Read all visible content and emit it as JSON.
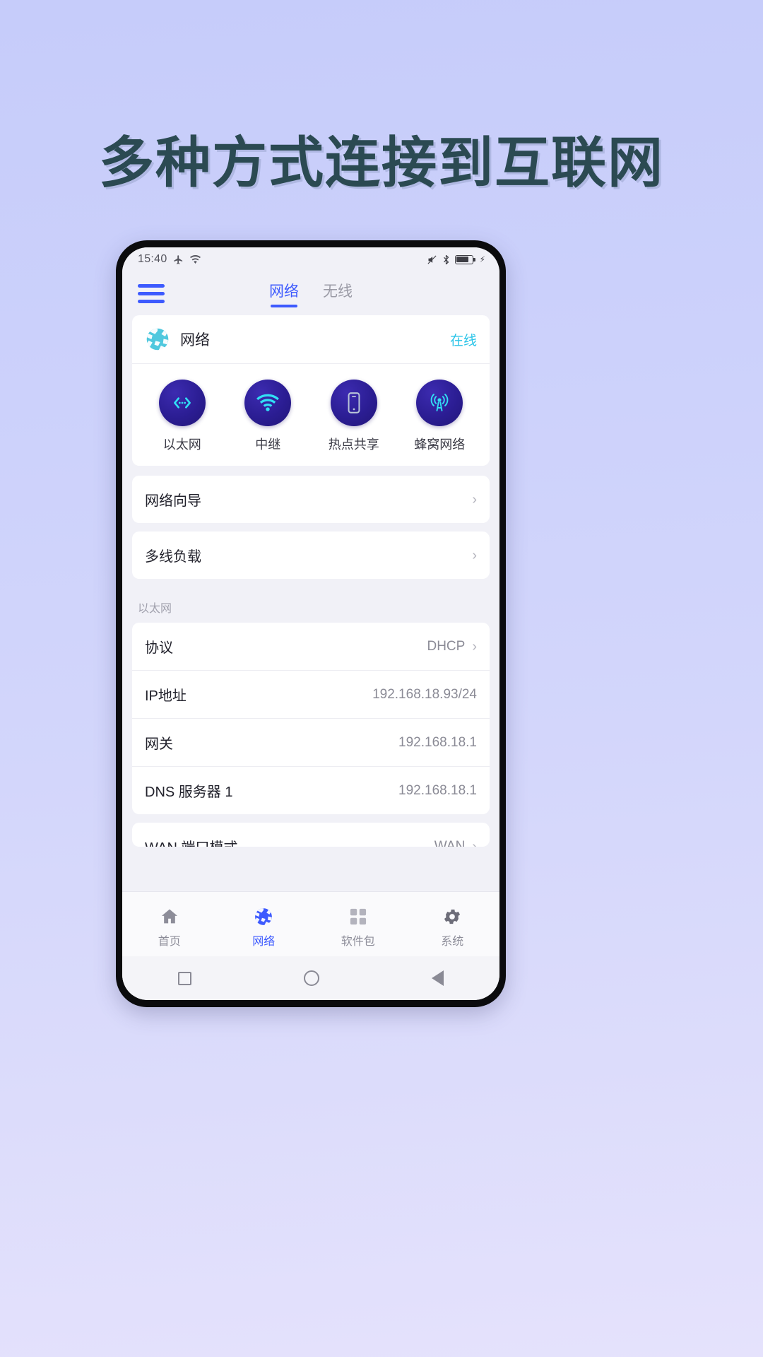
{
  "promo": {
    "headline": "多种方式连接到互联网",
    "headline_color": "#2b4a52",
    "background_color": "#ccd1fb"
  },
  "status_bar": {
    "time": "15:40",
    "icons": [
      "airplane-mode-icon",
      "wifi-icon"
    ],
    "right_icons": [
      "mute-icon",
      "bluetooth-icon",
      "battery-icon",
      "charging-bolt-icon"
    ]
  },
  "app_bar": {
    "menu_icon": "hamburger-menu-icon",
    "tabs": [
      {
        "label": "网络",
        "active": true
      },
      {
        "label": "无线",
        "active": false
      }
    ]
  },
  "network_card": {
    "icon": "globe-icon",
    "title": "网络",
    "status": "在线",
    "status_color": "#2bc4e8",
    "quick_actions": [
      {
        "label": "以太网",
        "icon": "ethernet-icon"
      },
      {
        "label": "中继",
        "icon": "wifi-repeater-icon"
      },
      {
        "label": "热点共享",
        "icon": "mobile-hotspot-icon"
      },
      {
        "label": "蜂窝网络",
        "icon": "cellular-tower-icon"
      }
    ]
  },
  "link_rows": [
    {
      "label": "网络向导",
      "chevron": "›"
    },
    {
      "label": "多线负载",
      "chevron": "›"
    }
  ],
  "ethernet_section": {
    "label": "以太网",
    "rows": [
      {
        "label": "协议",
        "value": "DHCP",
        "chevron": "›"
      },
      {
        "label": "IP地址",
        "value": "192.168.18.93/24",
        "chevron": ""
      },
      {
        "label": "网关",
        "value": "192.168.18.1",
        "chevron": ""
      },
      {
        "label": "DNS 服务器 1",
        "value": "192.168.18.1",
        "chevron": ""
      }
    ]
  },
  "partial_row": {
    "label": "WAN 端口模式",
    "value": "WAN",
    "chevron": "›"
  },
  "bottom_nav": [
    {
      "label": "首页",
      "icon": "home-icon",
      "active": false
    },
    {
      "label": "网络",
      "icon": "globe-icon",
      "active": true
    },
    {
      "label": "软件包",
      "icon": "packages-grid-icon",
      "active": false
    },
    {
      "label": "系统",
      "icon": "gear-icon",
      "active": false
    }
  ],
  "soft_keys": [
    "recents-square-icon",
    "home-circle-icon",
    "back-triangle-icon"
  ],
  "colors": {
    "accent_blue": "#3d5afe",
    "cyan": "#2bc4e8",
    "circle_indigo": "#2b1d93"
  }
}
